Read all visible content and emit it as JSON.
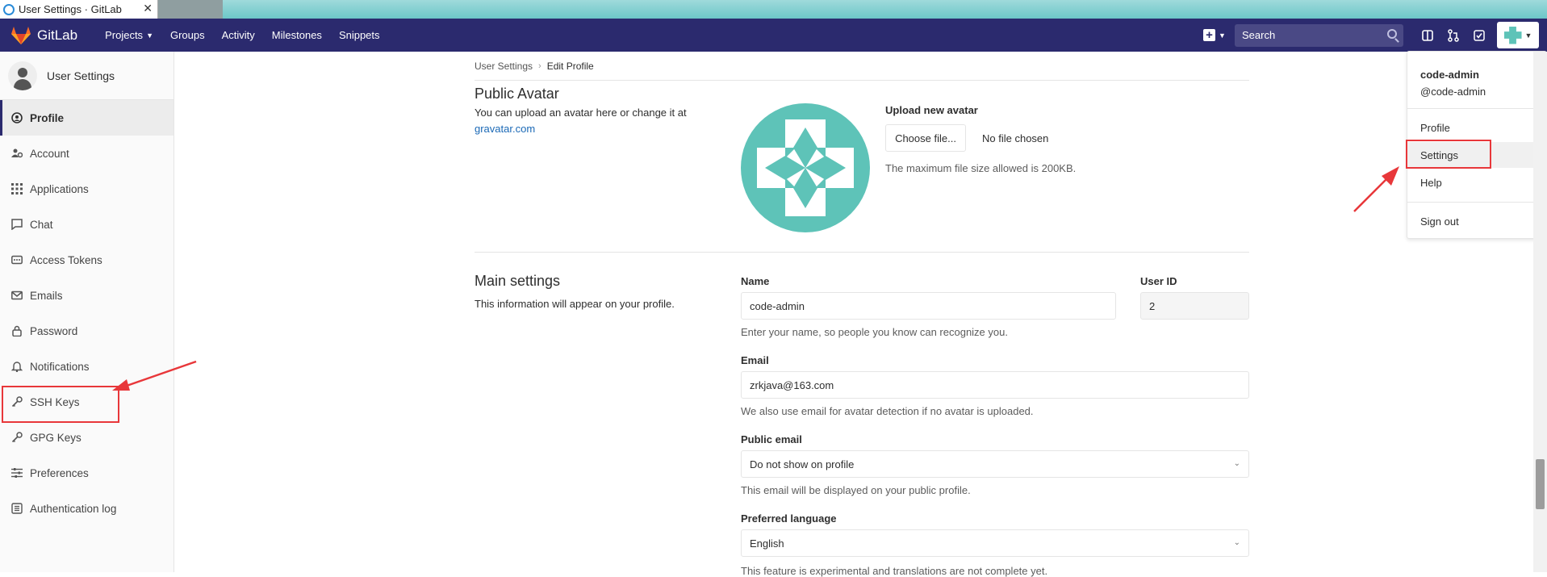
{
  "browser": {
    "tab_title": "User Settings · GitLab",
    "close": "✕"
  },
  "navbar": {
    "logo_text": "GitLab",
    "links": [
      "Projects",
      "Groups",
      "Activity",
      "Milestones",
      "Snippets"
    ],
    "search_placeholder": "Search"
  },
  "sidebar": {
    "title": "User Settings",
    "items": [
      {
        "label": "Profile",
        "icon": "profile-icon"
      },
      {
        "label": "Account",
        "icon": "account-icon"
      },
      {
        "label": "Applications",
        "icon": "applications-icon"
      },
      {
        "label": "Chat",
        "icon": "chat-icon"
      },
      {
        "label": "Access Tokens",
        "icon": "token-icon"
      },
      {
        "label": "Emails",
        "icon": "mail-icon"
      },
      {
        "label": "Password",
        "icon": "lock-icon"
      },
      {
        "label": "Notifications",
        "icon": "bell-icon"
      },
      {
        "label": "SSH Keys",
        "icon": "key-icon"
      },
      {
        "label": "GPG Keys",
        "icon": "key-icon"
      },
      {
        "label": "Preferences",
        "icon": "sliders-icon"
      },
      {
        "label": "Authentication log",
        "icon": "list-icon"
      }
    ]
  },
  "breadcrumb": {
    "parent": "User Settings",
    "current": "Edit Profile"
  },
  "avatar_section": {
    "title": "Public Avatar",
    "desc": "You can upload an avatar here or change it at",
    "link": "gravatar.com",
    "upload_title": "Upload new avatar",
    "choose_button": "Choose file...",
    "no_file": "No file chosen",
    "max_size": "The maximum file size allowed is 200KB."
  },
  "main_settings": {
    "title": "Main settings",
    "desc": "This information will appear on your profile.",
    "name_label": "Name",
    "name_value": "code-admin",
    "name_help": "Enter your name, so people you know can recognize you.",
    "userid_label": "User ID",
    "userid_value": "2",
    "email_label": "Email",
    "email_value": "zrkjava@163.com",
    "email_help": "We also use email for avatar detection if no avatar is uploaded.",
    "public_email_label": "Public email",
    "public_email_value": "Do not show on profile",
    "public_email_help": "This email will be displayed on your public profile.",
    "language_label": "Preferred language",
    "language_value": "English",
    "language_help": "This feature is experimental and translations are not complete yet."
  },
  "user_menu": {
    "name": "code-admin",
    "handle": "@code-admin",
    "items": [
      "Profile",
      "Settings",
      "Help",
      "Sign out"
    ]
  },
  "colors": {
    "navbar": "#2b2a6e",
    "annotation": "#e8373a",
    "avatar": "#5ec3b8",
    "link": "#1b69b6"
  }
}
